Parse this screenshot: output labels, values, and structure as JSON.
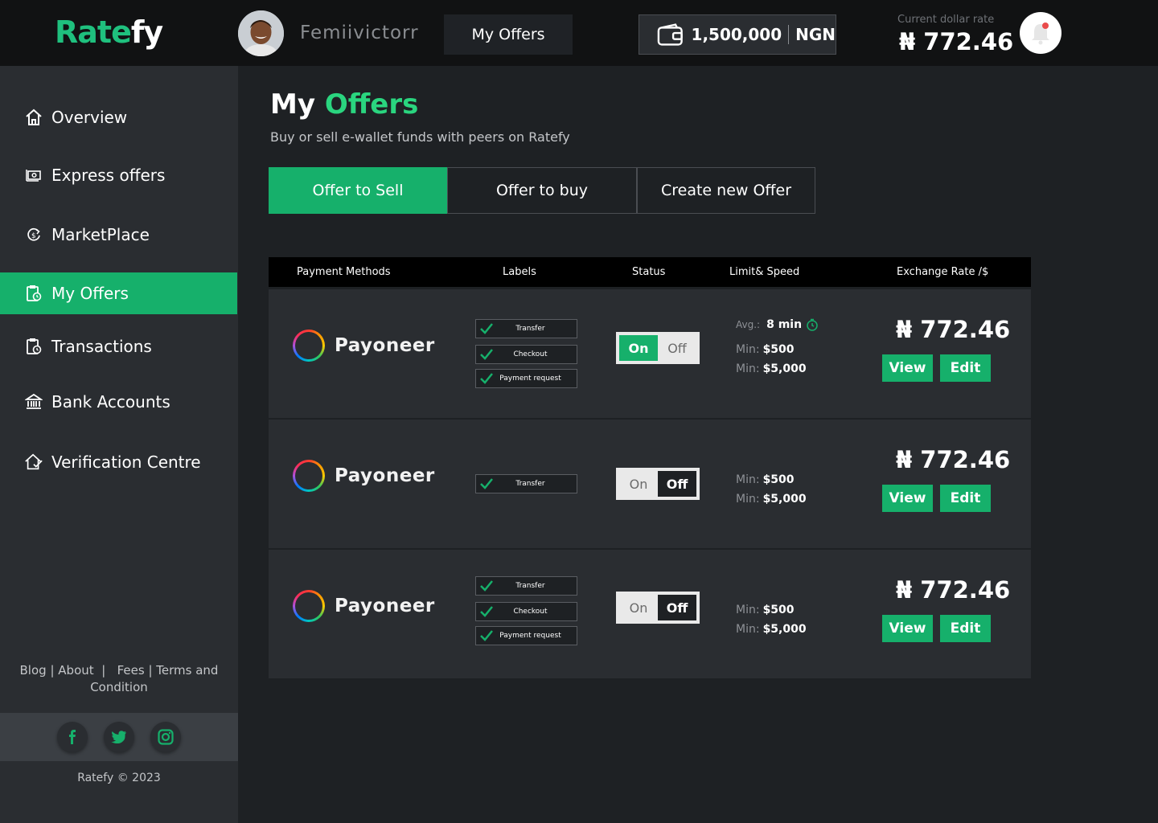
{
  "header": {
    "logo_green": "Rate",
    "logo_white": "fy",
    "username": "Femiivictorr",
    "nav_button": "My Offers",
    "wallet_amount": "1,500,000",
    "wallet_currency": "NGN",
    "rate_label": "Current dollar rate",
    "rate_value": "₦ 772.46"
  },
  "sidebar": {
    "items": [
      {
        "label": "Overview",
        "icon": "home-icon"
      },
      {
        "label": "Express offers",
        "icon": "express-offers-icon"
      },
      {
        "label": "MarketPlace",
        "icon": "marketplace-icon"
      },
      {
        "label": "My Offers",
        "icon": "offers-icon",
        "active": true
      },
      {
        "label": "Transactions",
        "icon": "transactions-icon"
      },
      {
        "label": "Bank Accounts",
        "icon": "bank-icon"
      },
      {
        "label": "Verification Centre",
        "icon": "verification-icon"
      }
    ],
    "footer_links": {
      "blog": "Blog",
      "about": "About",
      "fees": "Fees",
      "terms": "Terms and Condition"
    },
    "social": [
      "facebook-icon",
      "twitter-icon",
      "instagram-icon"
    ],
    "copyright": "Ratefy © 2023"
  },
  "main": {
    "title_white": "My",
    "title_green": "Offers",
    "subtitle": "Buy or sell e-wallet funds with peers on Ratefy",
    "tabs": [
      "Offer to Sell",
      "Offer to buy",
      "Create new Offer"
    ],
    "table_headers": [
      "Payment Methods",
      "Labels",
      "Status",
      "Limit& Speed",
      "Exchange Rate /$"
    ],
    "rows": [
      {
        "method": "Payoneer",
        "labels": [
          "Transfer",
          "Checkout",
          "Payment request"
        ],
        "status": "On",
        "toggle_on": "On",
        "toggle_off": "Off",
        "avg_label": "Avg.:",
        "avg_value": "8 min",
        "min_label": "Min:",
        "min_value": "$500",
        "max_label": "Min:",
        "max_value": "$5,000",
        "rate": "₦ 772.46",
        "view": "View",
        "edit": "Edit"
      },
      {
        "method": "Payoneer",
        "labels": [
          "Transfer"
        ],
        "status": "Off",
        "toggle_on": "On",
        "toggle_off": "Off",
        "min_label": "Min:",
        "min_value": "$500",
        "max_label": "Min:",
        "max_value": "$5,000",
        "rate": "₦ 772.46",
        "view": "View",
        "edit": "Edit"
      },
      {
        "method": "Payoneer",
        "labels": [
          "Transfer",
          "Checkout",
          "Payment request"
        ],
        "status": "Off",
        "toggle_on": "On",
        "toggle_off": "Off",
        "min_label": "Min:",
        "min_value": "$500",
        "max_label": "Min:",
        "max_value": "$5,000",
        "rate": "₦ 772.46",
        "view": "View",
        "edit": "Edit"
      }
    ]
  },
  "colors": {
    "accent": "#16b06b",
    "accent_text": "#2ad57f",
    "background": "#1e2124",
    "panel": "#2a2d31",
    "topbar": "#111213"
  }
}
